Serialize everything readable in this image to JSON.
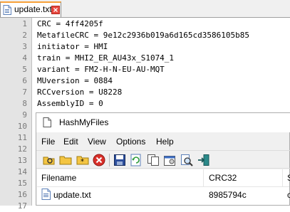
{
  "editor": {
    "tab": {
      "label": "update.txt",
      "icon": "document-icon",
      "close_icon": "close-icon"
    },
    "lines": [
      {
        "num": "1",
        "text": "CRC = 4ff4205f"
      },
      {
        "num": "2",
        "text": "MetafileCRC = 9e12c2936b019a6d165cd3586105b85"
      },
      {
        "num": "3",
        "text": "initiator = HMI"
      },
      {
        "num": "4",
        "text": "train = MHI2_ER_AU43x_S1074_1"
      },
      {
        "num": "5",
        "text": "variant = FM2-H-N-EU-AU-MQT"
      },
      {
        "num": "6",
        "text": "MUversion = 0884"
      },
      {
        "num": "7",
        "text": "RCCversion = U8228"
      },
      {
        "num": "8",
        "text": "AssemblyID = 0"
      },
      {
        "num": "9",
        "text": ""
      },
      {
        "num": "10",
        "text": ""
      },
      {
        "num": "11",
        "text": ""
      },
      {
        "num": "12",
        "text": ""
      },
      {
        "num": "13",
        "text": ""
      },
      {
        "num": "14",
        "text": ""
      },
      {
        "num": "15",
        "text": ""
      },
      {
        "num": "16",
        "text": ""
      },
      {
        "num": "17",
        "text": ""
      }
    ]
  },
  "hashmyfiles": {
    "title": "HashMyFiles",
    "menu": [
      "File",
      "Edit",
      "View",
      "Options",
      "Help"
    ],
    "toolbar_icons": [
      "open-files-icon",
      "open-folder-icon",
      "add-wildcard-icon",
      "clear-list-icon",
      "save-icon",
      "refresh-icon",
      "copy-icon",
      "properties-icon",
      "find-icon",
      "exit-icon"
    ],
    "columns": [
      "Filename",
      "CRC32",
      "S"
    ],
    "rows": [
      {
        "filename": "update.txt",
        "crc32": "8985794c",
        "extra": "c"
      }
    ]
  },
  "colors": {
    "tab_accent": "#f7a13a",
    "close_red": "#e8473e"
  }
}
